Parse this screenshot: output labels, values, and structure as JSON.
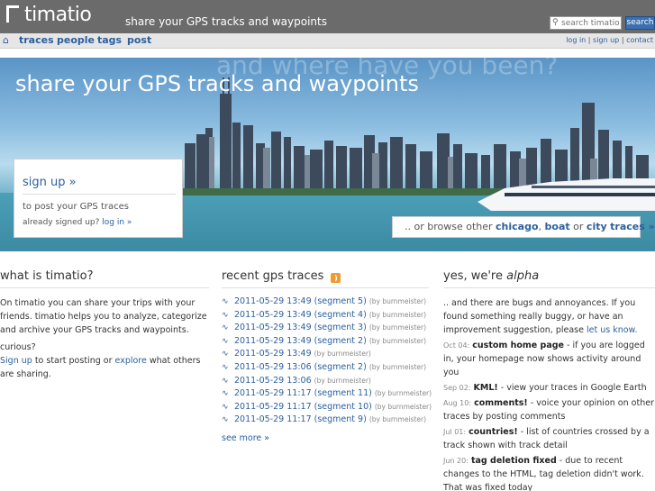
{
  "header": {
    "logo_text": "timatio",
    "tagline": "share your GPS tracks and waypoints",
    "search_placeholder": "search timatio",
    "search_button": "search"
  },
  "nav": {
    "items": [
      {
        "label": "traces"
      },
      {
        "label": "people"
      },
      {
        "label": "tags"
      },
      {
        "label": "post"
      }
    ],
    "login": "log in",
    "signup": "sign up",
    "contact": "contact",
    "separator": "|"
  },
  "hero": {
    "watermark": "and where have you been?",
    "title": "share your GPS tracks and waypoints",
    "signup_link": "sign up »",
    "signup_text": "to post your GPS traces",
    "already_text": "already signed up?",
    "login_link": "log in »",
    "browse_prefix": ".. or browse other",
    "browse_chicago": "chicago",
    "browse_comma": ",",
    "browse_boat": "boat",
    "browse_or": "or",
    "browse_city": "city",
    "browse_suffix": "traces »"
  },
  "what": {
    "heading": "what is timatio?",
    "paragraph": "On timatio you can share your trips with your friends. timatio helps you to analyze, categorize and archive your GPS tracks and waypoints.",
    "curious": "curious?",
    "signup_link": "Sign up",
    "middle": "to start posting or",
    "explore_link": "explore",
    "end": "what others are sharing."
  },
  "traces": {
    "heading": "recent gps traces",
    "rss_icon": "rss-feed-icon",
    "items": [
      {
        "title": "2011-05-29 13:49 (segment 5)",
        "by": "(by burnmeister)"
      },
      {
        "title": "2011-05-29 13:49 (segment 4)",
        "by": "(by burnmeister)"
      },
      {
        "title": "2011-05-29 13:49 (segment 3)",
        "by": "(by burnmeister)"
      },
      {
        "title": "2011-05-29 13:49 (segment 2)",
        "by": "(by burnmeister)"
      },
      {
        "title": "2011-05-29 13:49",
        "by": "(by burnmeister)"
      },
      {
        "title": "2011-05-29 13:06 (segment 2)",
        "by": "(by burnmeister)"
      },
      {
        "title": "2011-05-29 13:06",
        "by": "(by burnmeister)"
      },
      {
        "title": "2011-05-29 11:17 (segment 11)",
        "by": "(by burnmeister)"
      },
      {
        "title": "2011-05-29 11:17 (segment 10)",
        "by": "(by burnmeister)"
      },
      {
        "title": "2011-05-29 11:17 (segment 9)",
        "by": "(by burnmeister)"
      }
    ],
    "see_more": "see more »"
  },
  "alpha": {
    "heading_prefix": "yes, we're",
    "heading_alpha": "alpha",
    "intro": ".. and there are bugs and annoyances. If you found something really buggy, or have an improvement suggestion, please",
    "intro_link": "let us know.",
    "news": [
      {
        "date": "Oct 04:",
        "title": "custom home page",
        "text": "- if you are logged in, your homepage now shows activity around you"
      },
      {
        "date": "Sep 02:",
        "title": "KML!",
        "text": "- view your traces in Google Earth"
      },
      {
        "date": "Aug 10:",
        "title": "comments!",
        "text": "- voice your opinion on other traces by posting comments"
      },
      {
        "date": "Jul 01:",
        "title": "countries!",
        "text": "- list of countries crossed by a track shown with track detail"
      },
      {
        "date": "Jun 20:",
        "title": "tag deletion fixed",
        "text": "- due to recent changes to the HTML, tag deletion didn't work. That was fixed today"
      }
    ]
  },
  "colors": {
    "topbar": "#6b6b6b",
    "link": "#2b5f9e",
    "rss": "#f29a2e"
  }
}
